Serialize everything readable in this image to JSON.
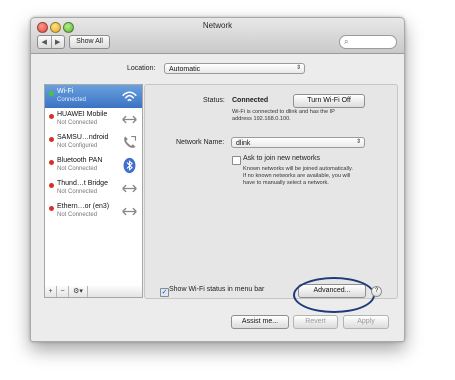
{
  "window": {
    "title": "Network",
    "toolbar": {
      "back_icon": "chevron-left-icon",
      "forward_icon": "chevron-right-icon",
      "show_all": "Show All",
      "search_icon": "search-icon"
    }
  },
  "location": {
    "label": "Location:",
    "value": "Automatic"
  },
  "services": [
    {
      "name": "Wi-Fi",
      "status": "Connected",
      "dot_color": "#4cc23a",
      "icon": "wifi-icon",
      "selected": true
    },
    {
      "name": "HUAWEI Mobile",
      "status": "Not Connected",
      "dot_color": "#d9312a",
      "icon": "arrows-icon"
    },
    {
      "name": "SAMSU…ndroid",
      "status": "Not Configured",
      "dot_color": "#d9312a",
      "icon": "phone-icon"
    },
    {
      "name": "Bluetooth PAN",
      "status": "Not Connected",
      "dot_color": "#d9312a",
      "icon": "bluetooth-icon"
    },
    {
      "name": "Thund…t Bridge",
      "status": "Not Connected",
      "dot_color": "#d9312a",
      "icon": "arrows-icon"
    },
    {
      "name": "Ethern…or (en3)",
      "status": "Not Connected",
      "dot_color": "#d9312a",
      "icon": "arrows-icon"
    }
  ],
  "sidebar_footer": {
    "add": "+",
    "remove": "−",
    "gear": "⚙▾"
  },
  "status": {
    "label": "Status:",
    "value": "Connected",
    "toggle_button": "Turn Wi-Fi Off",
    "desc_line1": "Wi-Fi is connected to dlink and has the IP",
    "desc_line2": "address 192.168.0.100."
  },
  "network_name": {
    "label": "Network Name:",
    "value": "dlink"
  },
  "ask_join": {
    "label": "Ask to join new networks",
    "checked": false,
    "help1": "Known networks will be joined automatically.",
    "help2": "If no known networks are available, you will",
    "help3": "have to manually select a network."
  },
  "show_status": {
    "label": "Show Wi-Fi status in menu bar",
    "checked": true
  },
  "buttons": {
    "advanced": "Advanced...",
    "help": "?",
    "assist": "Assist me...",
    "revert": "Revert",
    "apply": "Apply"
  },
  "colors": {
    "selection": "#3b73c4",
    "connected": "#4cc23a",
    "disconnected": "#d9312a",
    "highlight_ring": "#1f3a7a"
  }
}
